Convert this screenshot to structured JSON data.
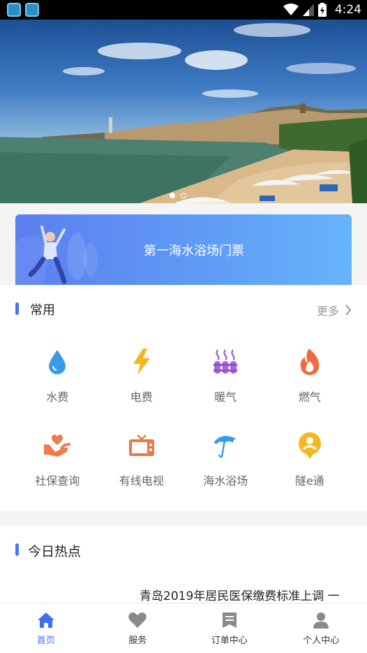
{
  "status_bar": {
    "time": "4:24"
  },
  "banner": {
    "slides": 2,
    "active_slide": 1
  },
  "ticket": {
    "label": "第一海水浴场门票"
  },
  "common": {
    "title": "常用",
    "more": "更多",
    "items": [
      {
        "label": "水费",
        "icon": "water-drop-icon",
        "color": "#3a9ce8"
      },
      {
        "label": "电费",
        "icon": "lightning-icon",
        "color": "#f5b81c"
      },
      {
        "label": "暖气",
        "icon": "radiator-icon",
        "color": "#a86ad6"
      },
      {
        "label": "燃气",
        "icon": "flame-icon",
        "color": "#ef6a3e"
      },
      {
        "label": "社保查询",
        "icon": "heart-hands-icon",
        "color": "#ee7a4d"
      },
      {
        "label": "有线电视",
        "icon": "tv-icon",
        "color": "#ef7646"
      },
      {
        "label": "海水浴场",
        "icon": "umbrella-icon",
        "color": "#3a9ce8"
      },
      {
        "label": "隧e通",
        "icon": "person-badge-icon",
        "color": "#f5b81c"
      }
    ]
  },
  "hot": {
    "title": "今日热点",
    "headline": "青岛2019年居民医保缴费标准上调 一"
  },
  "tabs": [
    {
      "label": "首页",
      "icon": "home-icon",
      "active": true
    },
    {
      "label": "服务",
      "icon": "heart-icon",
      "active": false
    },
    {
      "label": "订单中心",
      "icon": "order-list-icon",
      "active": false
    },
    {
      "label": "个人中心",
      "icon": "person-icon",
      "active": false
    }
  ],
  "colors": {
    "accent": "#4a74f5",
    "tab_active": "#3f6ff0",
    "tab_inactive": "#8a8a8a"
  }
}
